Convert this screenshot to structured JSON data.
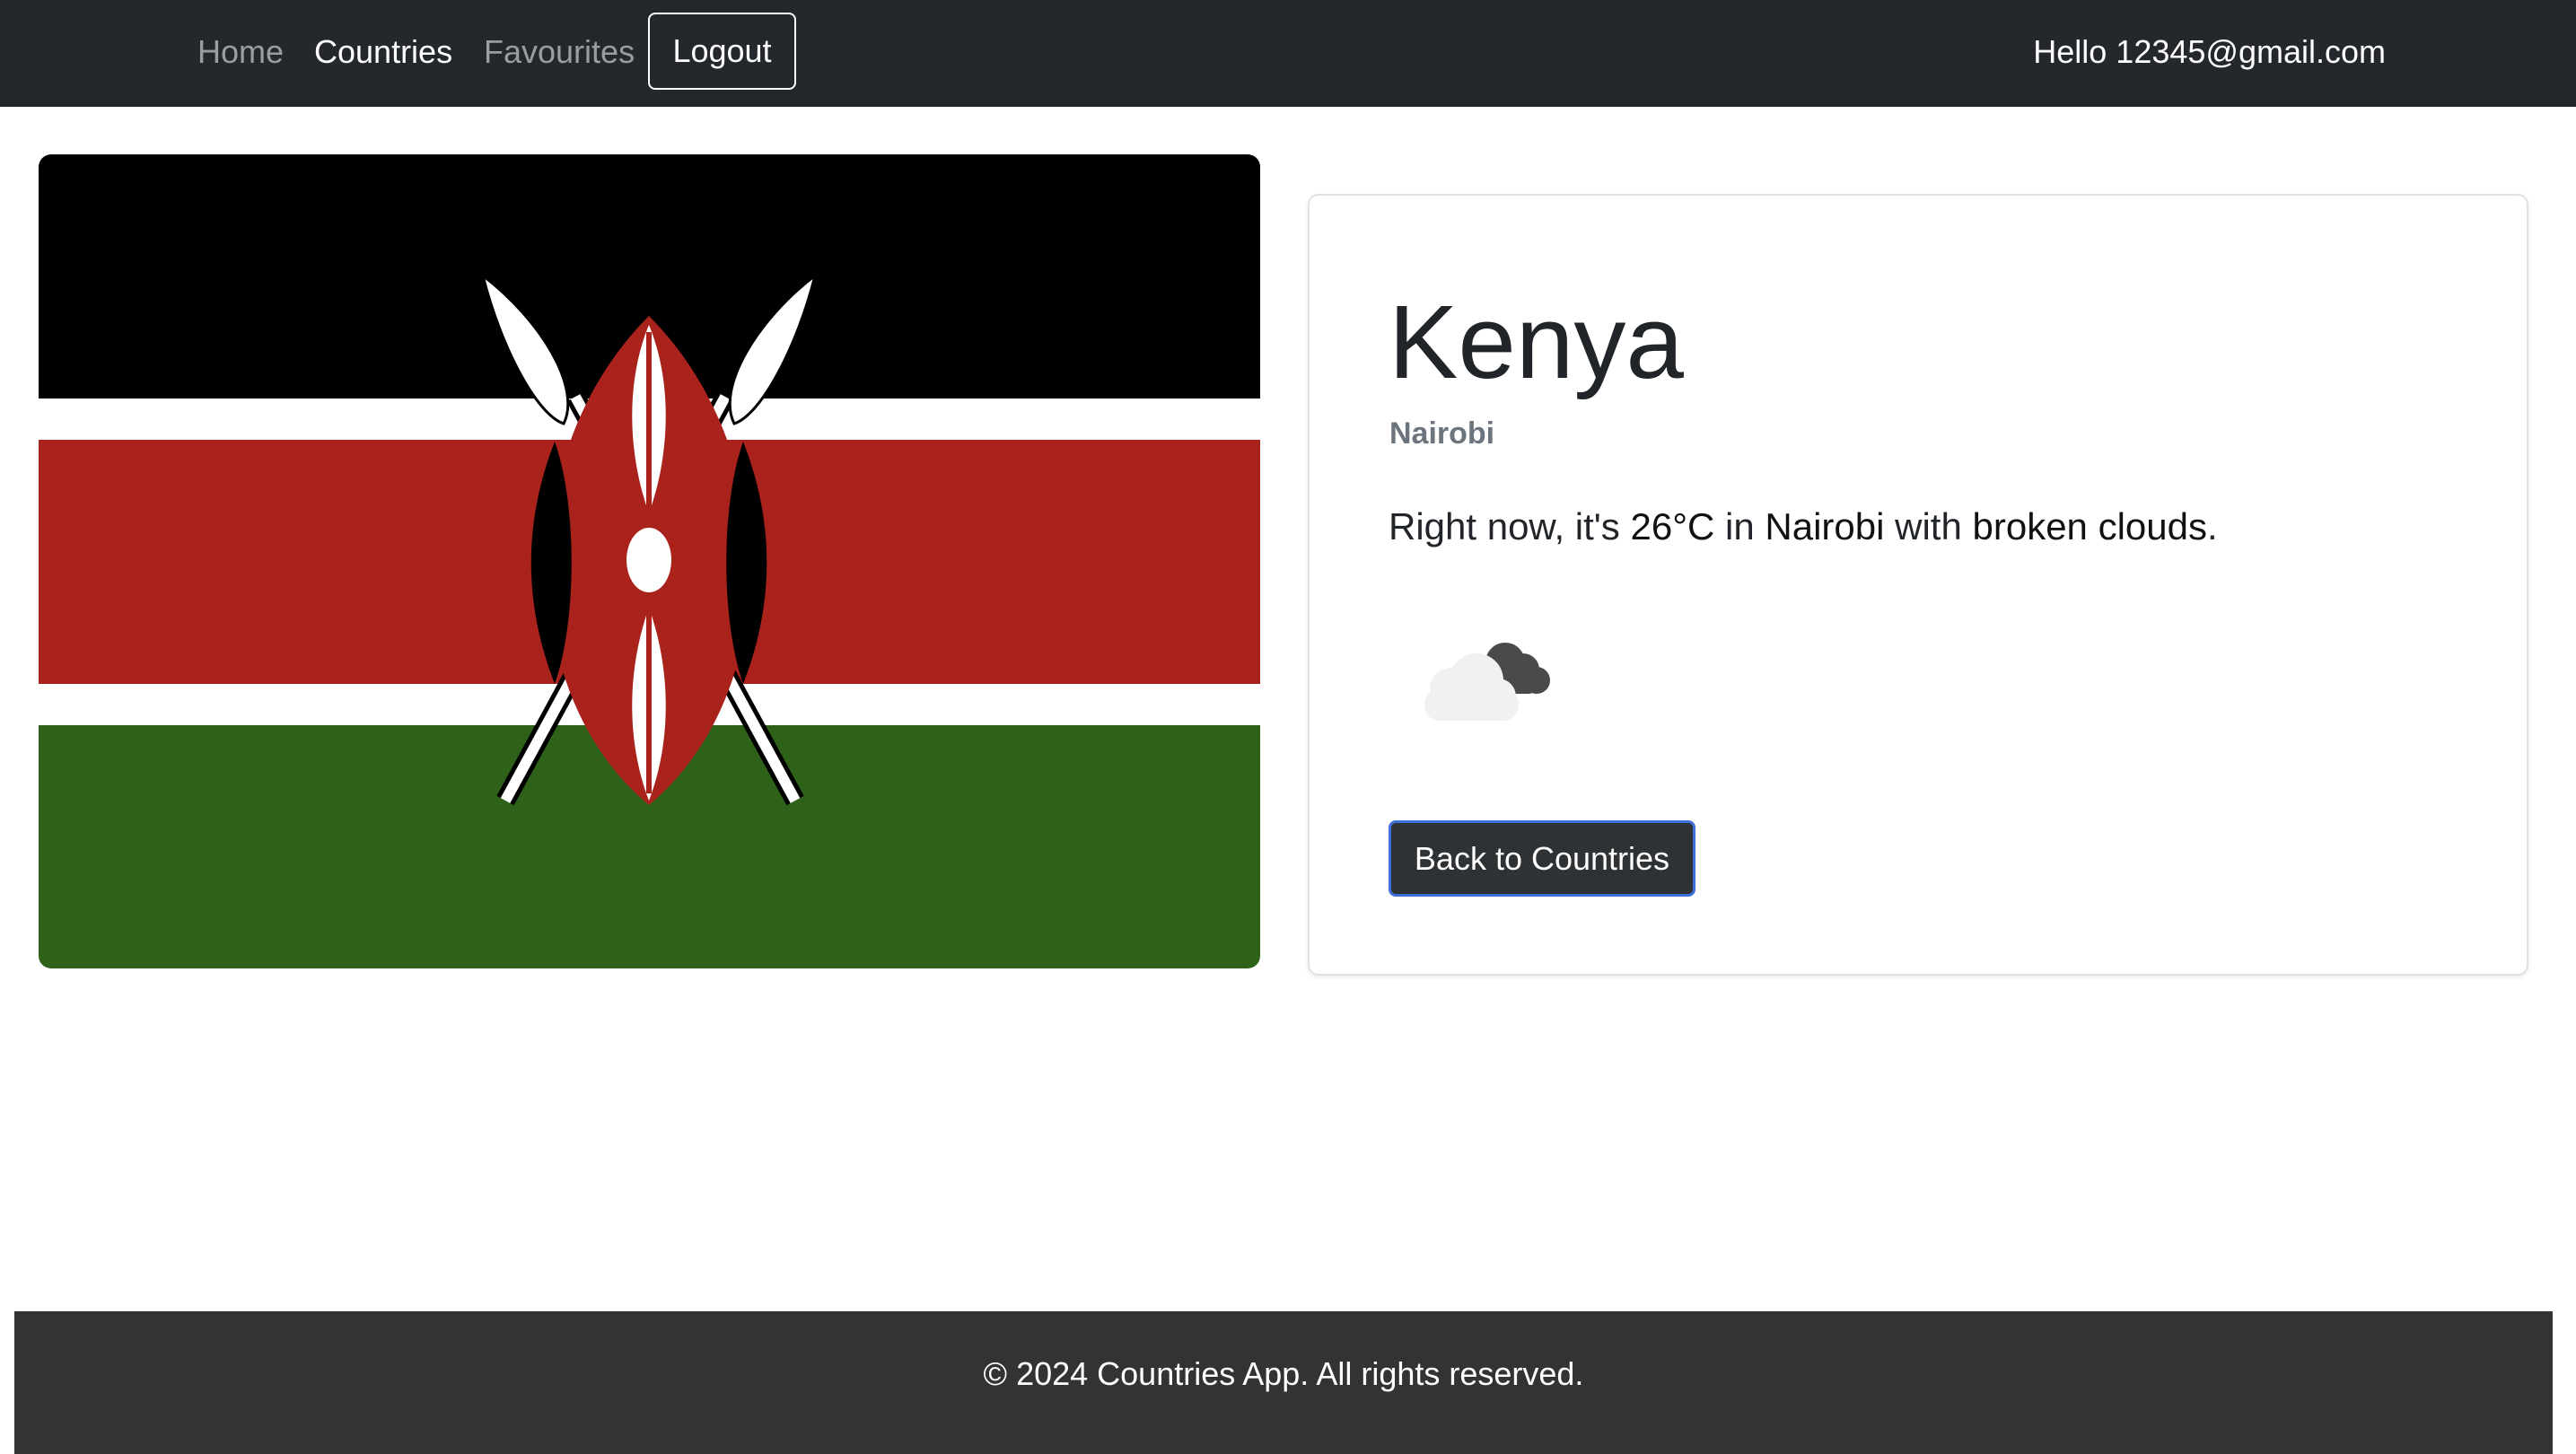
{
  "nav": {
    "home": "Home",
    "countries": "Countries",
    "favourites": "Favourites",
    "logout": "Logout",
    "greeting": "Hello 12345@gmail.com"
  },
  "country": {
    "name": "Kenya",
    "capital": "Nairobi",
    "flag_icon": "kenya-flag"
  },
  "weather": {
    "prefix": "Right now, it's",
    "temperature": "26°C",
    "in_word": "in",
    "city": "Nairobi",
    "with_word": "with",
    "description": "broken clouds",
    "suffix": ".",
    "icon": "broken-clouds-icon"
  },
  "actions": {
    "back": "Back to Countries"
  },
  "footer": {
    "text": "© 2024 Countries App. All rights reserved."
  },
  "colors": {
    "navbar": "#24272b",
    "flag_black": "#000000",
    "flag_red": "#a9231c",
    "flag_green": "#2e6219",
    "footer": "#333333",
    "button": "#2f3235"
  }
}
